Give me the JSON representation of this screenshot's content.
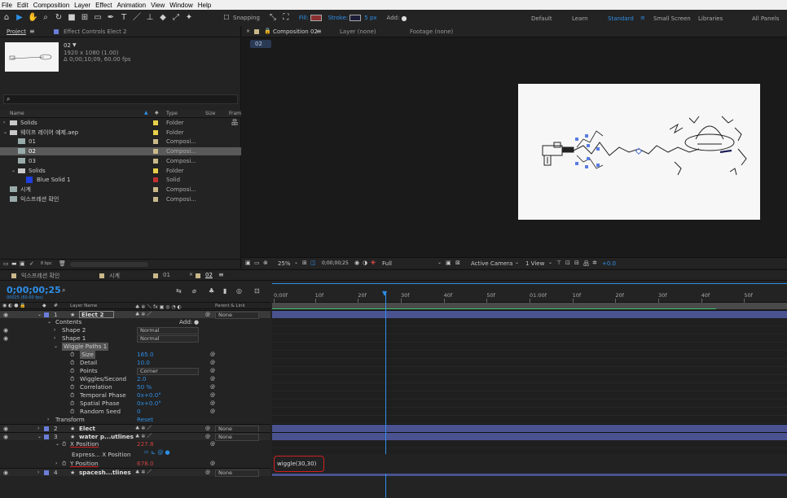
{
  "menu": [
    "File",
    "Edit",
    "Composition",
    "Layer",
    "Effect",
    "Animation",
    "View",
    "Window",
    "Help"
  ],
  "toolbar": {
    "snapping": "Snapping",
    "fill": "Fill:",
    "stroke": "Stroke:",
    "stroke_px": "5 px",
    "add": "Add:",
    "workspaces": [
      "Default",
      "Learn",
      "Standard",
      "Small Screen",
      "Libraries",
      "All Panels"
    ],
    "active_workspace": "Standard"
  },
  "project": {
    "tab": "Project",
    "effect_controls_tab": "Effect Controls Elect 2",
    "item_name": "02",
    "item_dims": "1920 x 1080 (1.00)",
    "item_duration": "Δ 0;00;10;09, 60.00 fps",
    "search_placeholder": "",
    "columns": {
      "name": "Name",
      "type": "Type",
      "size": "Size",
      "frame": "Fram"
    },
    "items": [
      {
        "name": "Solids",
        "type": "Folder",
        "color": "#e8d04a",
        "kind": "folder",
        "indent": 0,
        "selected": false
      },
      {
        "name": "웨이프 레이어 예제.aep",
        "type": "Folder",
        "color": "#e8d04a",
        "kind": "folder",
        "indent": 0,
        "selected": false
      },
      {
        "name": "01",
        "type": "Composi...",
        "color": "#c9b98a",
        "kind": "comp",
        "indent": 1,
        "selected": false
      },
      {
        "name": "02",
        "type": "Composi...",
        "color": "#c9b98a",
        "kind": "comp",
        "indent": 1,
        "selected": true
      },
      {
        "name": "03",
        "type": "Composi...",
        "color": "#c9b98a",
        "kind": "comp",
        "indent": 1,
        "selected": false
      },
      {
        "name": "Solids",
        "type": "Folder",
        "color": "#e8d04a",
        "kind": "folder",
        "indent": 1,
        "selected": false
      },
      {
        "name": "Blue Solid 1",
        "type": "Solid",
        "color": "#c03030",
        "kind": "solid",
        "indent": 2,
        "selected": false
      },
      {
        "name": "시계",
        "type": "Composi...",
        "color": "#c9b98a",
        "kind": "comp",
        "indent": 0,
        "selected": false
      },
      {
        "name": "익스프레션 확인",
        "type": "Composi...",
        "color": "#c9b98a",
        "kind": "comp",
        "indent": 0,
        "selected": false
      }
    ],
    "bpc": "8 bpc"
  },
  "composition": {
    "tab": "Composition 02",
    "layer_tab": "Layer (none)",
    "footage_tab": "Footage (none)",
    "crumb": "02",
    "zoom": "25%",
    "timecode": "0;00;00;25",
    "resolution": "Full",
    "camera": "Active Camera",
    "view": "1 View",
    "exposure": "+0.0"
  },
  "timeline": {
    "tabs": [
      {
        "name": "익스프레션 확인",
        "color": "#c9b98a",
        "active": false
      },
      {
        "name": "시계",
        "color": "#c9b98a",
        "active": false
      },
      {
        "name": "01",
        "color": "#c9b98a",
        "active": false
      },
      {
        "name": "02",
        "color": "#c9b98a",
        "active": true
      }
    ],
    "current_time": "0;00;00;25",
    "fps_info": "00025 (60.00 fps)",
    "col_layer_name": "Layer Name",
    "col_parent": "Parent & Link",
    "ruler": [
      "0;00f",
      "10f",
      "20f",
      "30f",
      "40f",
      "50f",
      "01:00f",
      "10f",
      "20f",
      "30f",
      "40f",
      "50f"
    ],
    "playhead_fraction": 0.22,
    "expression_text": "wiggle(30,30)",
    "rows": [
      {
        "kind": "layer",
        "num": "1",
        "name": "Elect 2",
        "parent": "None",
        "color": "#6a7ed8",
        "selected": true
      },
      {
        "kind": "group",
        "name": "Contents",
        "add": "Add:"
      },
      {
        "kind": "prop",
        "name": "Shape 2",
        "value": "Normal",
        "indent": 1,
        "select": true
      },
      {
        "kind": "prop",
        "name": "Shape 1",
        "value": "Normal",
        "indent": 1,
        "select": true
      },
      {
        "kind": "group",
        "name": "Wiggle Paths 1",
        "indent": 1
      },
      {
        "kind": "param",
        "name": "Size",
        "value": "165.0"
      },
      {
        "kind": "param",
        "name": "Detail",
        "value": "10.0"
      },
      {
        "kind": "param",
        "name": "Points",
        "value": "Corner",
        "select": true
      },
      {
        "kind": "param",
        "name": "Wiggles/Second",
        "value": "2.0"
      },
      {
        "kind": "param",
        "name": "Correlation",
        "value": "50 %"
      },
      {
        "kind": "param",
        "name": "Temporal Phase",
        "value": "0x+0.0°"
      },
      {
        "kind": "param",
        "name": "Spatial Phase",
        "value": "0x+0.0°"
      },
      {
        "kind": "param",
        "name": "Random Seed",
        "value": "0"
      },
      {
        "kind": "group",
        "name": "Transform",
        "value": "Reset"
      },
      {
        "kind": "layer",
        "num": "2",
        "name": "Elect",
        "parent": "None",
        "color": "#6a7ed8",
        "selected": false
      },
      {
        "kind": "layer",
        "num": "3",
        "name": "water p...utlines",
        "parent": "None",
        "color": "#6a7ed8",
        "selected": false
      },
      {
        "kind": "xpos",
        "name": "X Position",
        "value": "227.8"
      },
      {
        "kind": "expr",
        "name": "Express... X Position"
      },
      {
        "kind": "ypos",
        "name": "Y Position",
        "value": "678.0"
      },
      {
        "kind": "layer",
        "num": "4",
        "name": "spacesh...tlines",
        "parent": "None",
        "color": "#6a7ed8",
        "selected": false
      }
    ]
  },
  "colors": {
    "accent": "#2e8fe8",
    "layer_bar": "#4a5290",
    "red_value": "#d04040"
  }
}
